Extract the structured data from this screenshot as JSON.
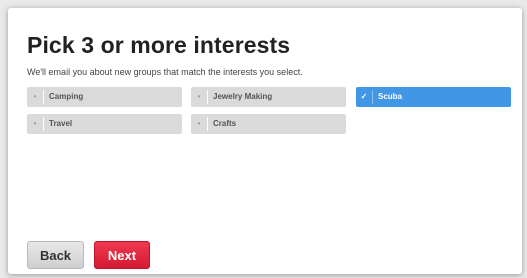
{
  "title": "Pick 3 or more interests",
  "subtitle": "We'll email you about new groups that match the interests you select.",
  "interests": [
    {
      "label": "Camping",
      "selected": false,
      "mark": "•"
    },
    {
      "label": "Jewelry Making",
      "selected": false,
      "mark": "•"
    },
    {
      "label": "Scuba",
      "selected": true,
      "mark": "✓"
    },
    {
      "label": "Travel",
      "selected": false,
      "mark": "•"
    },
    {
      "label": "Crafts",
      "selected": false,
      "mark": "•"
    }
  ],
  "buttons": {
    "back_label": "Back",
    "next_label": "Next"
  },
  "colors": {
    "selected_chip": "#4296e6",
    "unselected_chip": "#dadada",
    "next_button": "#e0233b",
    "back_button": "#dcdcdc"
  }
}
